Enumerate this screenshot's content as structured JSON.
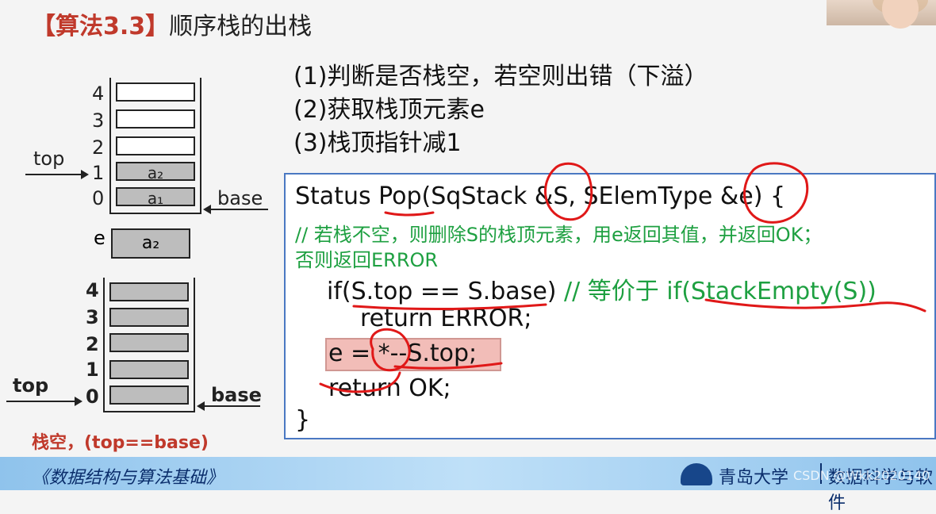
{
  "title": {
    "bracket_label": "【算法3.3】",
    "text": "顺序栈的出栈"
  },
  "stack1": {
    "indices": [
      "4",
      "3",
      "2",
      "1",
      "0"
    ],
    "cells": [
      "",
      "",
      "",
      "a₂",
      "a₁"
    ],
    "top_label": "top",
    "base_label": "base"
  },
  "e_var": {
    "label": "e",
    "value": "a₂"
  },
  "stack2": {
    "indices": [
      "4",
      "3",
      "2",
      "1",
      "0"
    ],
    "top_label": "top",
    "base_label": "base",
    "caption": "栈空，(top==base)"
  },
  "steps": [
    "(1)判断是否栈空，若空则出错（下溢）",
    "(2)获取栈顶元素e",
    "(3)栈顶指针减1"
  ],
  "code": {
    "line1": "Status Pop(SqStack &S, SElemType &e) {",
    "comment1": "// 若栈不空，则删除S的栈顶元素，用e返回其值，并返回OK；",
    "comment2": "否则返回ERROR",
    "if_code": "if(S.top == S.base)",
    "if_comment": "  // 等价于 if(StackEmpty(S))",
    "return_error": "return ERROR;",
    "assign": "e = *--S.top;",
    "return_ok": "return OK;",
    "close": "}"
  },
  "footer": {
    "left": "《数据结构与算法基础》",
    "university": "青岛大学",
    "dept": "数据科学与软件",
    "watermark": "CSDN @Wkk2020140"
  },
  "colors": {
    "title_highlight": "#c0392b",
    "comment_green": "#1ea041",
    "annotation_red": "#e01818",
    "code_border": "#4a78c2",
    "footer_blue": "#8fc3ec"
  }
}
